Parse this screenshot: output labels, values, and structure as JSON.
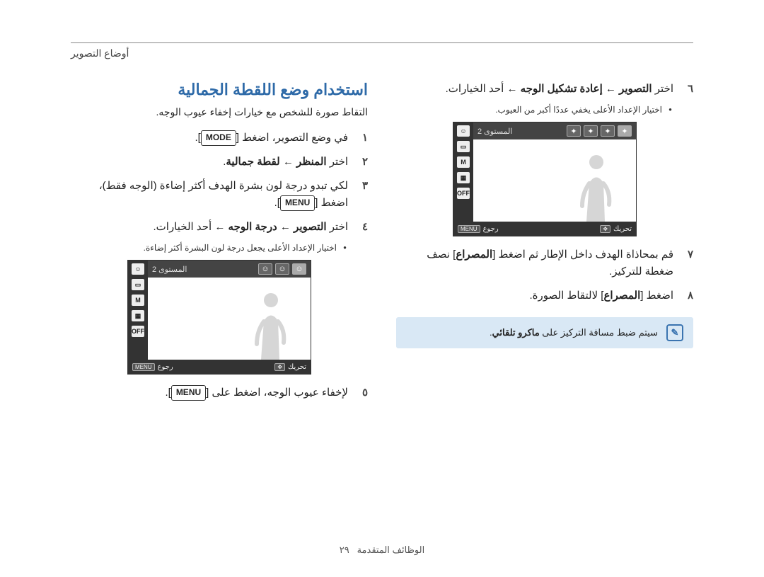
{
  "header": {
    "section": "أوضاع التصوير"
  },
  "title": "استخدام وضع اللقطة الجمالية",
  "intro": "التقاط صورة للشخص مع خيارات إخفاء عيوب الوجه.",
  "right_steps": {
    "s1": {
      "num": "١",
      "pre": "في وضع التصوير، اضغط [",
      "btn": "MODE",
      "post": "]."
    },
    "s2": {
      "num": "٢",
      "pre": "اختر ",
      "b1": "المنظر",
      "mid": " ← ",
      "b2": "لقطة جمالية",
      "post": "."
    },
    "s3": {
      "num": "٣",
      "line1": "لكي تبدو درجة لون بشرة الهدف أكثر إضاءة (الوجه فقط)،",
      "line2_pre": "اضغط [",
      "btn": "MENU",
      "line2_post": "]."
    },
    "s4": {
      "num": "٤",
      "pre": "اختر ",
      "b1": "التصوير",
      "mid": " ← ",
      "b2": "درجة الوجه",
      "post": " ← أحد الخيارات."
    },
    "s4_note": "اختيار الإعداد الأعلى يجعل درجة لون البشرة أكثر إضاءة.",
    "s5": {
      "num": "٥",
      "pre": "لإخفاء عيوب الوجه، اضغط على [",
      "btn": "MENU",
      "post": "]."
    }
  },
  "left_steps": {
    "s6": {
      "num": "٦",
      "pre": "اختر ",
      "b1": "التصوير",
      "mid1": " ← ",
      "b2": "إعادة تشكيل الوجه",
      "post": " ← أحد الخيارات."
    },
    "s6_note": "اختيار الإعداد الأعلى يخفي عددًا أكبر من العيوب.",
    "s7": {
      "num": "٧",
      "pre": "قم بمحاذاة الهدف داخل الإطار ثم اضغط [",
      "b1": "المصراع",
      "post": "] نصف ضغطة للتركيز."
    },
    "s8": {
      "num": "٨",
      "pre": "اضغط [",
      "b1": "المصراع",
      "post": "] لالتقاط الصورة."
    }
  },
  "note": {
    "text_pre": "سيتم ضبط مسافة التركيز على ",
    "bold": "ماكرو تلقائي",
    "text_post": "."
  },
  "screen": {
    "level": "المستوى 2",
    "move": "تحريك",
    "back": "رجوع",
    "menu": "MENU",
    "side_labels": [
      "",
      "",
      "M",
      "",
      "OFF"
    ]
  },
  "footer": {
    "label": "الوظائف المتقدمة",
    "page": "٢٩"
  }
}
